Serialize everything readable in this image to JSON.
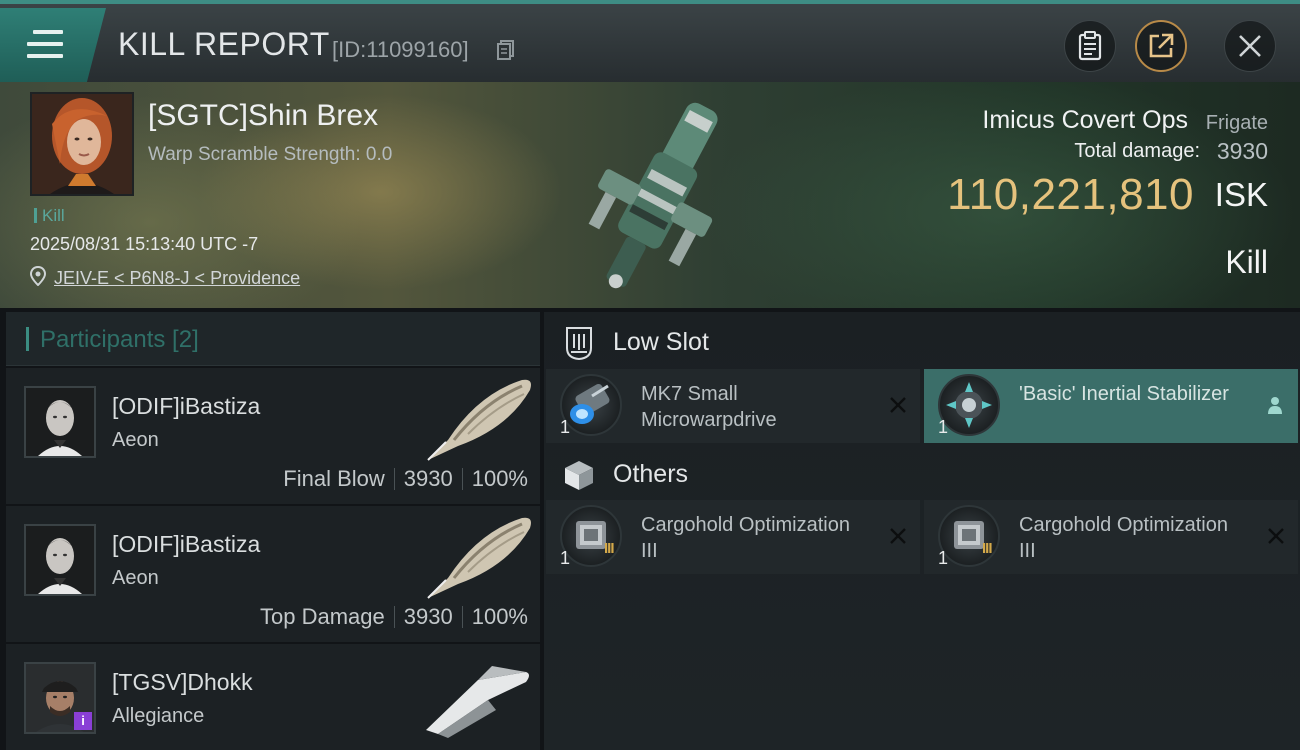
{
  "header": {
    "title": "KILL REPORT",
    "report_id": "[ID:11099160]",
    "icons": [
      "menu-icon",
      "copy-icon",
      "clipboard-icon",
      "share-icon",
      "close-icon"
    ]
  },
  "victim": {
    "name": "[SGTC]Shin Brex",
    "warp_scramble": "Warp Scramble Strength: 0.0",
    "kill_tag": "Kill",
    "datetime": "2025/08/31 15:13:40 UTC -7",
    "location": "JEIV-E < P6N8-J < Providence",
    "ship_name": "Imicus Covert Ops",
    "ship_class": "Frigate",
    "damage_label": "Total damage:",
    "damage_value": "3930",
    "isk_value": "110,221,810",
    "isk_unit": "ISK",
    "result": "Kill"
  },
  "participants": {
    "header": "Participants [2]",
    "rows": [
      {
        "name": "[ODIF]iBastiza",
        "ship": "Aeon",
        "role": "Final Blow",
        "damage": "3930",
        "percent": "100%"
      },
      {
        "name": "[ODIF]iBastiza",
        "ship": "Aeon",
        "role": "Top Damage",
        "damage": "3930",
        "percent": "100%"
      },
      {
        "name": "[TGSV]Dhokk",
        "ship": "Allegiance",
        "badge": "i"
      }
    ]
  },
  "sections": {
    "low_slot": {
      "title": "Low Slot",
      "items": [
        {
          "name": "MK7 Small Microwarpdrive",
          "qty": "1",
          "state": "destroyed"
        },
        {
          "name": "'Basic' Inertial Stabilizer",
          "qty": "1",
          "state": "dropped"
        }
      ]
    },
    "others": {
      "title": "Others",
      "items": [
        {
          "name": "Cargohold Optimization III",
          "qty": "1",
          "tier": "III",
          "state": "destroyed"
        },
        {
          "name": "Cargohold Optimization III",
          "qty": "1",
          "tier": "III",
          "state": "destroyed"
        }
      ]
    }
  },
  "colors": {
    "accent_teal": "#3e8d84",
    "isk_gold": "#e5c27d",
    "slot_highlight": "#3b6e69",
    "badge_purple": "#8a3fd6"
  }
}
